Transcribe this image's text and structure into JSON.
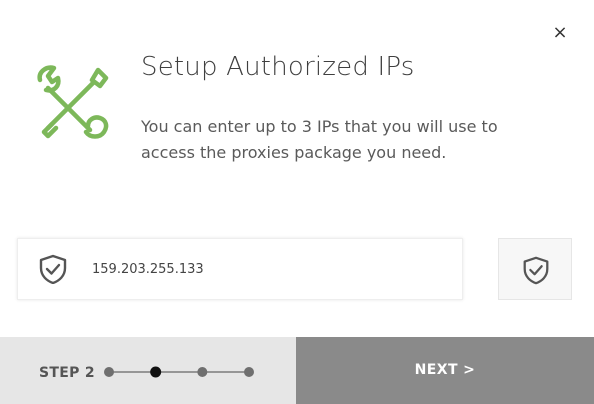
{
  "dialog": {
    "close_label": "×",
    "title": "Setup Authorized IPs",
    "description": "You can enter up to 3 IPs that you will use to access the proxies package you need.",
    "header_icon": "wrench-screwdriver-icon",
    "accent_color": "#7db85a"
  },
  "ip_entry": {
    "value": "159.203.255.133",
    "field_icon": "shield-check-icon",
    "confirm_icon": "shield-check-icon"
  },
  "footer": {
    "step_label": "STEP 2",
    "steps_total": 4,
    "current_step": 2,
    "next_label": "NEXT >",
    "left_bg": "#e6e6e6",
    "next_bg": "#8a8a8a"
  }
}
